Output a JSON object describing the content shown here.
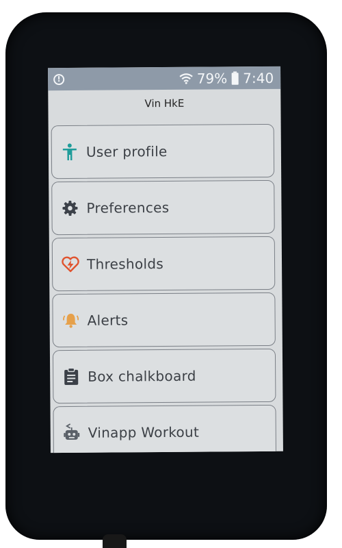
{
  "status_bar": {
    "battery": "79%",
    "time": "7:40",
    "alert_glyph": "!"
  },
  "header": {
    "device_name": "Vin HkE"
  },
  "menu": {
    "items": [
      {
        "label": "User profile",
        "icon": "person-icon",
        "color": "#1f9c9a"
      },
      {
        "label": "Preferences",
        "icon": "gear-icon",
        "color": "#3b4048"
      },
      {
        "label": "Thresholds",
        "icon": "heart-bolt-icon",
        "color": "#e0532e"
      },
      {
        "label": "Alerts",
        "icon": "bell-icon",
        "color": "#e6a04a"
      },
      {
        "label": "Box chalkboard",
        "icon": "clipboard-icon",
        "color": "#3b4048"
      },
      {
        "label": "Vinapp Workout",
        "icon": "robot-icon",
        "color": "#5a6068"
      }
    ]
  }
}
